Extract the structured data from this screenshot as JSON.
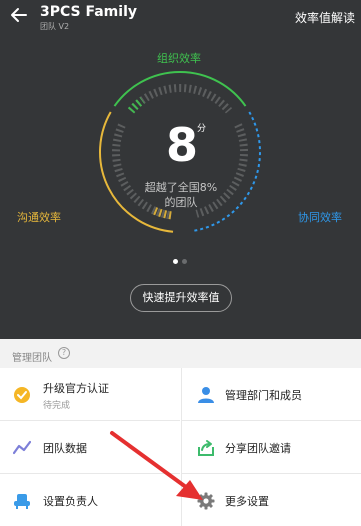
{
  "header": {
    "title": "3PCS Family",
    "subtitle": "团队 V2",
    "right_link": "效率值解读"
  },
  "gauge": {
    "score": "8",
    "unit": "分",
    "description": "超越了全国8%的团队",
    "label_org": "组织效率",
    "label_comm": "沟通效率",
    "label_coop": "协同效率",
    "colors": {
      "org": "#3fc24f",
      "comm": "#e7b83b",
      "coop": "#2f98ea"
    }
  },
  "pager": {
    "pages": 2,
    "current": 1
  },
  "quick_button": "快速提升效率值",
  "manage": {
    "section_title": "管理团队",
    "help_glyph": "?",
    "items": [
      {
        "label": "升级官方认证",
        "sub": "待完成",
        "icon": "verified-badge-icon"
      },
      {
        "label": "管理部门和成员",
        "icon": "person-icon"
      },
      {
        "label": "团队数据",
        "icon": "trend-chart-icon"
      },
      {
        "label": "分享团队邀请",
        "icon": "share-icon"
      },
      {
        "label": "设置负责人",
        "icon": "seat-icon"
      },
      {
        "label": "更多设置",
        "icon": "gear-icon"
      }
    ]
  }
}
